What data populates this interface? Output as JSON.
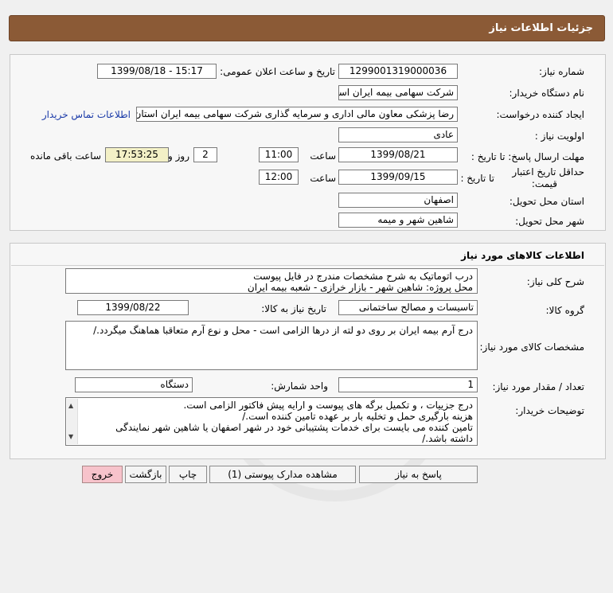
{
  "header": {
    "title": "جزئیات اطلاعات نیاز"
  },
  "info": {
    "need_number_label": "شماره نیاز:",
    "need_number": "1299001319000036",
    "announce_label": "تاریخ و ساعت اعلان عمومی:",
    "announce_value": "1399/08/18 - 15:17",
    "buyer_org_label": "نام دستگاه خریدار:",
    "buyer_org": "شرکت سهامی بیمه ایران استان اصفهان",
    "requester_label": "ایجاد کننده درخواست:",
    "requester": "رضا پزشکی معاون مالی اداری و سرمایه گذاری شرکت سهامی بیمه ایران استان",
    "contact_link": "اطلاعات تماس خریدار",
    "priority_label": "اولویت نیاز :",
    "priority": "عادی",
    "deadline_label": "مهلت ارسال پاسخ: تا تاریخ :",
    "deadline_date": "1399/08/21",
    "time_label": "ساعت",
    "deadline_time": "11:00",
    "days_value": "2",
    "days_label": "روز و",
    "remaining_time": "17:53:25",
    "remaining_label": "ساعت باقی مانده",
    "validity_label_1": "حداقل تاریخ اعتبار",
    "validity_label_2": "قیمت:",
    "validity_until_label": "تا تاریخ :",
    "validity_date": "1399/09/15",
    "validity_time": "12:00",
    "province_label": "استان محل تحویل:",
    "province": "اصفهان",
    "city_label": "شهر محل تحویل:",
    "city": "شاهین شهر و میمه"
  },
  "goods": {
    "section_title": "اطلاعات کالاهای مورد نیاز",
    "description_label": "شرح کلی نیاز:",
    "description_lines": [
      "درب اتوماتیک به شرح مشخصات مندرج در فایل پیوست",
      "محل پروژه: شاهین شهر - بازار خرازی - شعبه بیمه ایران"
    ],
    "group_label": "گروه کالا:",
    "group": "تاسیسات و مصالح ساختمانی",
    "need_date_label": "تاریخ نیاز به کالا:",
    "need_date": "1399/08/22",
    "specs_label": "مشخصات کالای مورد نیاز:",
    "specs": "درج آرم بیمه ایران بر روی دو لته از درها الزامی است - محل و نوع آرم متعاقبا هماهنگ میگردد./",
    "qty_label": "تعداد / مقدار مورد نیاز:",
    "qty": "1",
    "unit_label": "واحد شمارش:",
    "unit": "دستگاه",
    "buyer_notes_label": "توضیحات خریدار:",
    "buyer_notes_lines": [
      "درج جزییات ، و تکمیل برگه های پیوست و ارایه پیش فاکتور الزامی است.",
      "هزینه بارگیری حمل و تخلیه بار بر عهده تامین کننده است./",
      "تامین کننده می بایست برای خدمات پشتیبانی خود در شهر اصفهان یا شاهین شهر نمایندگی",
      "داشته باشد./"
    ]
  },
  "buttons": {
    "reply": "پاسخ به نیاز",
    "view_docs": "مشاهده مدارک پیوستی (1)",
    "print": "چاپ",
    "back": "بازگشت",
    "exit": "خروج"
  },
  "colors": {
    "header_bg": "#8b5a36",
    "remaining_bg": "#f3f0c6",
    "exit_bg": "#f7c3cb",
    "link": "#1a3aa8"
  }
}
